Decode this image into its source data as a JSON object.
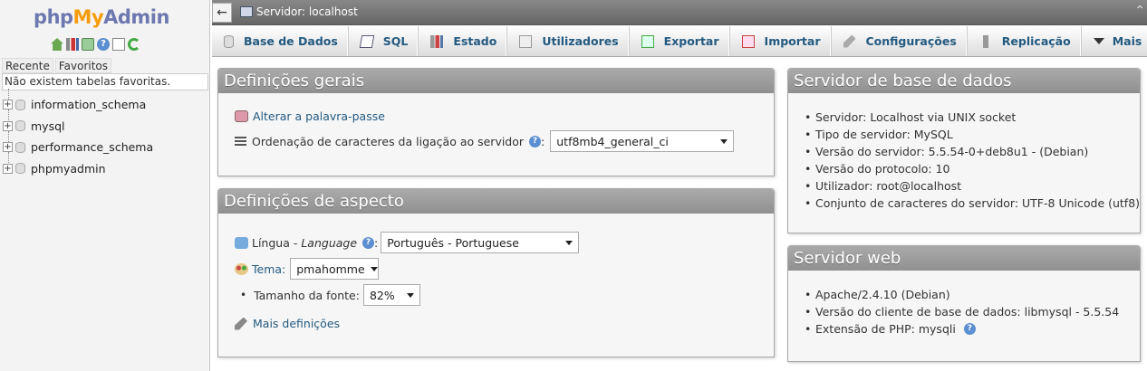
{
  "nav": {
    "logo": {
      "php": "php",
      "my": "My",
      "admin": "Admin"
    },
    "icons": [
      "home-icon",
      "bar-chart-icon",
      "exit-icon",
      "help-icon",
      "docs-icon",
      "reload-icon"
    ],
    "tabs": [
      "Recente",
      "Favoritos"
    ],
    "favorites_message": "Não existem tabelas favoritas.",
    "databases": [
      "information_schema",
      "mysql",
      "performance_schema",
      "phpmyadmin"
    ],
    "expander": "+"
  },
  "topbar": {
    "back": "←",
    "server_label": "Servidor: localhost",
    "collapse": "⌃"
  },
  "menu": [
    {
      "label": "Base de Dados",
      "icon": "database-icon"
    },
    {
      "label": "SQL",
      "icon": "sql-icon"
    },
    {
      "label": "Estado",
      "icon": "status-icon"
    },
    {
      "label": "Utilizadores",
      "icon": "users-icon"
    },
    {
      "label": "Exportar",
      "icon": "export-icon"
    },
    {
      "label": "Importar",
      "icon": "import-icon"
    },
    {
      "label": "Configurações",
      "icon": "wrench-icon"
    },
    {
      "label": "Replicação",
      "icon": "replication-icon"
    },
    {
      "label": "Mais",
      "icon": "dropdown-icon"
    }
  ],
  "general": {
    "title": "Definições gerais",
    "change_password": "Alterar a palavra-passe",
    "collation_label": "Ordenação de caracteres da ligação ao servidor",
    "collation_value": "utf8mb4_general_ci"
  },
  "appearance": {
    "title": "Definições de aspecto",
    "language_label": "Língua - ",
    "language_label_italic": "Language",
    "language_value": "Português - Portuguese",
    "theme_label": "Tema:",
    "theme_value": "pmahomme",
    "font_size_label": "Tamanho da fonte:",
    "font_size_value": "82%",
    "more_settings": "Mais definições",
    "colon": ":"
  },
  "db_server": {
    "title": "Servidor de base de dados",
    "items": [
      "Servidor: Localhost via UNIX socket",
      "Tipo de servidor: MySQL",
      "Versão do servidor: 5.5.54-0+deb8u1 - (Debian)",
      "Versão do protocolo: 10",
      "Utilizador: root@localhost",
      "Conjunto de caracteres do servidor: UTF-8 Unicode (utf8)"
    ]
  },
  "web_server": {
    "title": "Servidor web",
    "items": [
      "Apache/2.4.10 (Debian)",
      "Versão do cliente de base de dados: libmysql - 5.5.54",
      "Extensão de PHP: mysqli"
    ]
  },
  "help_glyph": "?"
}
